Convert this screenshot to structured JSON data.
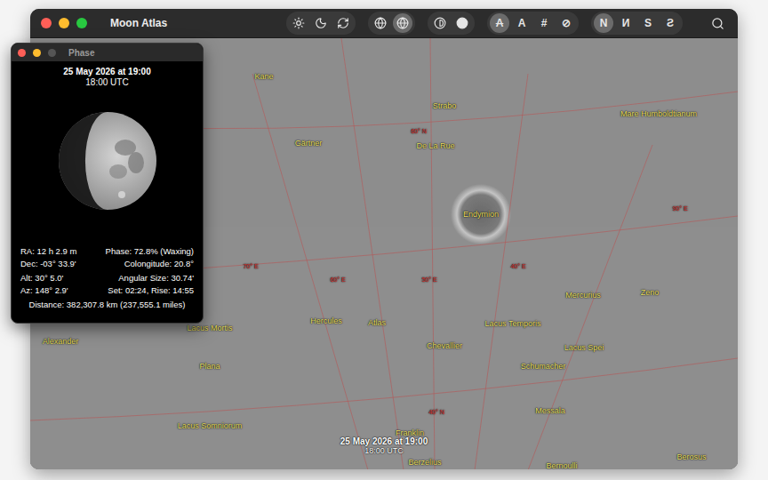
{
  "window": {
    "title": "Moon Atlas"
  },
  "toolbar": {
    "groups": [
      {
        "buttons": [
          {
            "kind": "icon",
            "selected": false
          },
          {
            "kind": "icon",
            "selected": false
          },
          {
            "kind": "icon",
            "selected": false
          }
        ]
      },
      {
        "buttons": [
          {
            "kind": "icon",
            "selected": false
          },
          {
            "kind": "icon",
            "selected": true
          }
        ]
      },
      {
        "buttons": [
          {
            "kind": "icon",
            "selected": false
          },
          {
            "kind": "icon",
            "selected": false
          }
        ]
      },
      {
        "buttons": [
          {
            "kind": "text",
            "label": "A",
            "struck": true,
            "selected": true
          },
          {
            "kind": "text",
            "label": "A",
            "struck": false,
            "selected": false
          },
          {
            "kind": "text",
            "label": "#",
            "struck": false,
            "selected": false
          },
          {
            "kind": "text",
            "label": "⊘",
            "struck": false,
            "selected": false
          }
        ]
      },
      {
        "buttons": [
          {
            "kind": "text",
            "label": "N",
            "struck": false,
            "selected": true
          },
          {
            "kind": "text",
            "label": "И",
            "struck": false,
            "selected": false
          },
          {
            "kind": "text",
            "label": "S",
            "struck": false,
            "selected": false
          },
          {
            "kind": "text",
            "label": "Ƨ",
            "struck": false,
            "selected": false
          }
        ]
      }
    ]
  },
  "phase_panel": {
    "title": "Phase",
    "date": "25 May 2026 at 19:00",
    "utc": "18:00 UTC",
    "level": 0.728,
    "rows": [
      {
        "left": "RA: 12 h 2.9 m",
        "right": "Phase: 72.8% (Waxing)"
      },
      {
        "left": "Dec: -03° 33.9'",
        "right": "Colongitude: 20.8°"
      },
      {
        "left": "Alt: 30° 5.0'",
        "right": "Angular Size: 30.74'"
      },
      {
        "left": "Az: 148° 2.9'",
        "right": "Set: 02:24, Rise: 14:55"
      }
    ],
    "distance": "Distance: 382,307.8 km (237,555.1 miles)"
  },
  "map": {
    "labels": [
      {
        "text": "Kane",
        "kind": "feature"
      },
      {
        "text": "Strabo",
        "kind": "feature"
      },
      {
        "text": "Mare Humboldtianum",
        "kind": "feature"
      },
      {
        "text": "Gärtner",
        "kind": "feature"
      },
      {
        "text": "De La Rue",
        "kind": "feature"
      },
      {
        "text": "Endymion",
        "kind": "feature"
      },
      {
        "text": "Mercurius",
        "kind": "feature"
      },
      {
        "text": "Zeno",
        "kind": "feature"
      },
      {
        "text": "Hercules",
        "kind": "feature"
      },
      {
        "text": "Atlas",
        "kind": "feature"
      },
      {
        "text": "Lacus Mortis",
        "kind": "feature"
      },
      {
        "text": "Lacus Temporis",
        "kind": "feature"
      },
      {
        "text": "Chevallier",
        "kind": "feature"
      },
      {
        "text": "Alexander",
        "kind": "feature"
      },
      {
        "text": "Lacus Spei",
        "kind": "feature"
      },
      {
        "text": "Schumacher",
        "kind": "feature"
      },
      {
        "text": "Plana",
        "kind": "feature"
      },
      {
        "text": "Messala",
        "kind": "feature"
      },
      {
        "text": "Lacus Somniorum",
        "kind": "feature"
      },
      {
        "text": "Franklin",
        "kind": "feature"
      },
      {
        "text": "Berzelius",
        "kind": "feature"
      },
      {
        "text": "Bernoulli",
        "kind": "feature"
      },
      {
        "text": "Berosus",
        "kind": "feature"
      },
      {
        "text": "60° N",
        "kind": "grid"
      },
      {
        "text": "90° E",
        "kind": "grid"
      },
      {
        "text": "70° E",
        "kind": "grid"
      },
      {
        "text": "60° E",
        "kind": "grid"
      },
      {
        "text": "50° E",
        "kind": "grid"
      },
      {
        "text": "40° E",
        "kind": "grid"
      },
      {
        "text": "40° N",
        "kind": "grid"
      }
    ],
    "timestamp": {
      "date": "25 May 2026 at 19:00",
      "utc": "18:00 UTC"
    }
  }
}
